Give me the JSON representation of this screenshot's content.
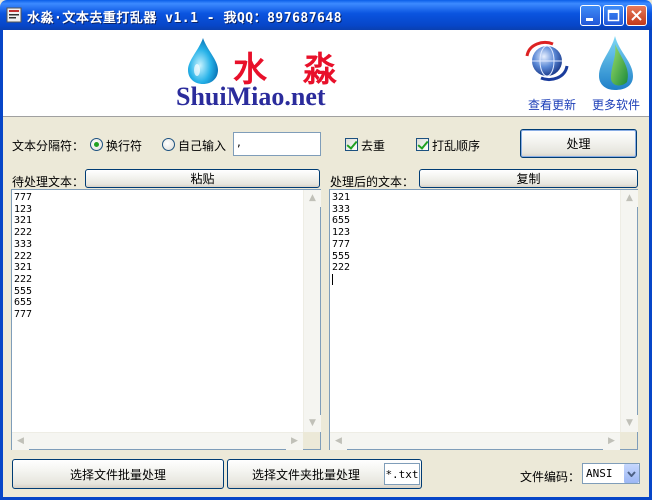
{
  "window": {
    "title": "水淼·文本去重打乱器 v1.1 - 我QQ：897687648"
  },
  "banner": {
    "brand_cn": "水 淼",
    "brand_en": "ShuiMiao.net",
    "check_update": "查看更新",
    "more_software": "更多软件"
  },
  "options": {
    "separator_label": "文本分隔符：",
    "newline_label": "换行符",
    "newline_selected": true,
    "custom_label": "自己输入",
    "custom_selected": false,
    "custom_value": ",",
    "dedupe_label": "去重",
    "dedupe_checked": true,
    "shuffle_label": "打乱顺序",
    "shuffle_checked": true,
    "process_button": "处理"
  },
  "input_panel": {
    "label": "待处理文本：",
    "paste_button": "粘贴",
    "lines": [
      "777",
      "123",
      "321",
      "222",
      "333",
      "222",
      "321",
      "222",
      "555",
      "655",
      "777"
    ]
  },
  "output_panel": {
    "label": "处理后的文本：",
    "copy_button": "复制",
    "lines": [
      "321",
      "333",
      "655",
      "123",
      "777",
      "555",
      "222"
    ]
  },
  "footer": {
    "batch_files_button": "选择文件批量处理",
    "batch_folder_button": "选择文件夹批量处理",
    "extension_filter": "*.txt",
    "encoding_label": "文件编码：",
    "encoding_value": "ANSI"
  },
  "colors": {
    "titlebar": "#0a54e0",
    "brand_red": "#e8102a",
    "brand_blue": "#2b2c9c",
    "link_blue": "#1d3fb8",
    "check_green": "#21a121"
  }
}
